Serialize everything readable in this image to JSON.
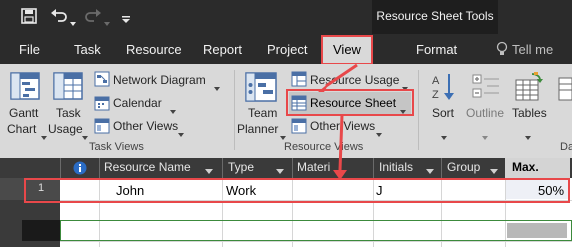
{
  "title_bar": {
    "save_icon": "save-icon",
    "undo_icon": "undo-icon",
    "redo_icon": "redo-icon",
    "customize_icon": "chevron-down-icon",
    "context_title": "Resource Sheet Tools"
  },
  "tabs": [
    {
      "label": "File"
    },
    {
      "label": "Task"
    },
    {
      "label": "Resource"
    },
    {
      "label": "Report"
    },
    {
      "label": "Project"
    },
    {
      "label": "View",
      "selected": true
    },
    {
      "label": "Format"
    }
  ],
  "tell_me": "Tell me",
  "ribbon": {
    "task_views": {
      "group_label": "Task Views",
      "gantt_chart": {
        "line1": "Gantt",
        "line2": "Chart"
      },
      "task_usage": {
        "line1": "Task",
        "line2": "Usage"
      },
      "network_diagram": "Network Diagram",
      "calendar": "Calendar",
      "other_views": "Other Views"
    },
    "resource_views": {
      "group_label": "Resource Views",
      "team_planner": {
        "line1": "Team",
        "line2": "Planner"
      },
      "resource_usage": "Resource Usage",
      "resource_sheet": "Resource Sheet",
      "other_views": "Other Views"
    },
    "data": {
      "sort": "Sort",
      "outline": "Outline",
      "tables": "Tables",
      "group_label_partial": "Da"
    }
  },
  "sheet": {
    "columns": [
      "Resource Name",
      "Type",
      "Materi",
      "Initials",
      "Group",
      "Max."
    ],
    "info_icon": "info-icon",
    "rows": [
      {
        "id": "1",
        "name": "John",
        "type": "Work",
        "material": "",
        "initials": "J",
        "group": "",
        "max": "50%"
      }
    ]
  },
  "colors": {
    "dark_bar": "#2b2b2b",
    "ribbon_bg": "#d9d9d9",
    "highlight": "#e8484a",
    "accent_green": "#3c8a3c"
  }
}
